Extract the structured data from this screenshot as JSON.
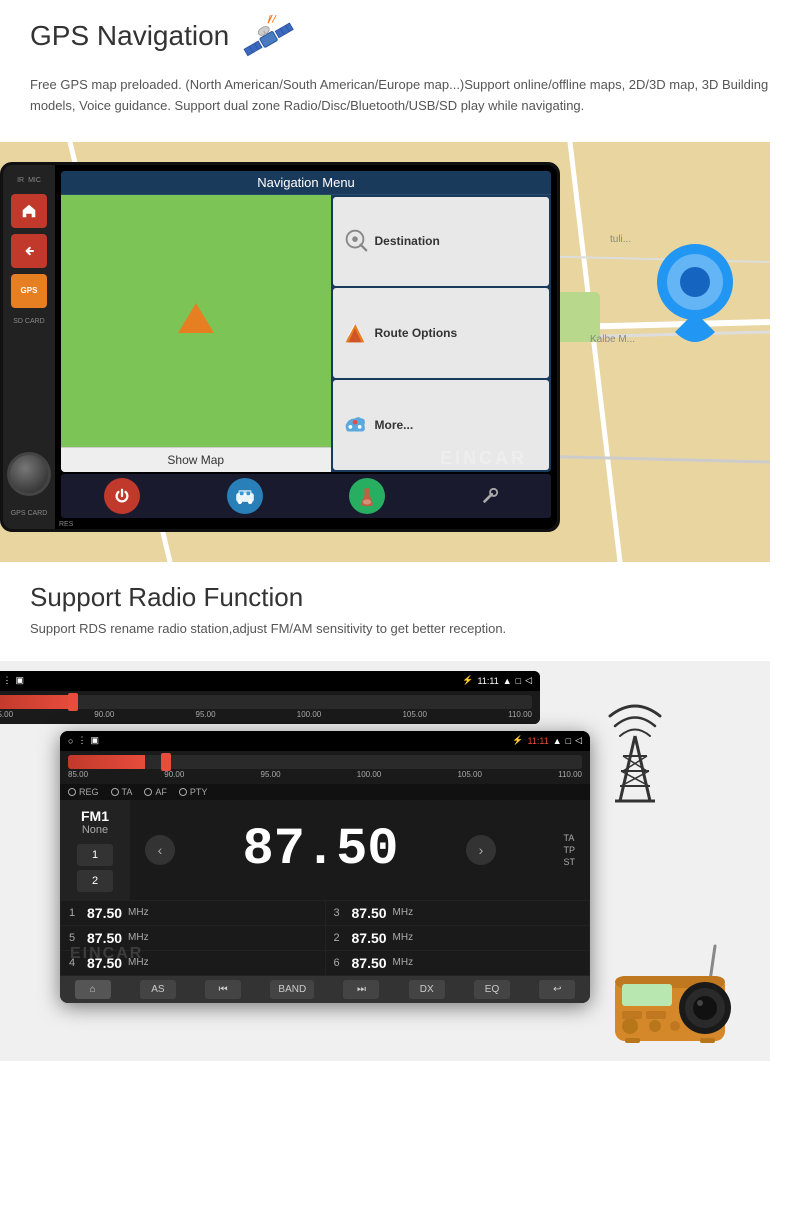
{
  "gps": {
    "title": "GPS Navigation",
    "description": "Free GPS map preloaded. (North American/South American/Europe map...)Support online/offline maps, 2D/3D map, 3D Building models, Voice guidance.\nSupport dual zone Radio/Disc/Bluetooth/USB/SD play while navigating.",
    "nav_menu_title": "Navigation Menu",
    "destination_label": "Destination",
    "route_options_label": "Route Options",
    "more_label": "More...",
    "show_map_label": "Show Map",
    "gps_side_label": "GPS",
    "ir_label": "IR",
    "mic_label": "MIC",
    "res_label": "RES",
    "sd_label": "SD CARD",
    "gps_slot_label": "GPS CARD",
    "eincar_label": "EINCAR"
  },
  "radio": {
    "title": "Support Radio Function",
    "description": "Support RDS rename radio station,adjust FM/AM sensitivity to get better reception.",
    "fm_label": "FM1",
    "fm_sub": "None",
    "frequency": "87.50",
    "freq_min": "85.00",
    "freq_marks": [
      "85.00",
      "90.00",
      "95.00",
      "100.00",
      "105.00",
      "110.00"
    ],
    "time": "11:11",
    "ta_label": "TA",
    "tp_label": "TP",
    "st_label": "ST",
    "reg_options": [
      "REG",
      "TA",
      "AF",
      "PTY"
    ],
    "presets": [
      {
        "num": "1",
        "freq": "87.50",
        "mhz": "MHz"
      },
      {
        "num": "3",
        "freq": "87.50",
        "mhz": "MHz"
      },
      {
        "num": "5",
        "freq": "87.50",
        "mhz": "MHz"
      },
      {
        "num": "2",
        "freq": "87.50",
        "mhz": "MHz"
      },
      {
        "num": "4",
        "freq": "87.50",
        "mhz": "MHz"
      },
      {
        "num": "6",
        "freq": "87.50",
        "mhz": "MHz"
      }
    ],
    "bottom_btns": [
      "🏠",
      "AS",
      "⏮",
      "BAND",
      "⏭",
      "DX",
      "EQ",
      "↩"
    ],
    "eincar_label": "EINCAR"
  },
  "icons": {
    "satellite": "🛰️",
    "home": "⌂",
    "back": "↩",
    "power": "⏻",
    "tools": "🔧",
    "bluetooth": "⚡",
    "signal_tower": "📡"
  }
}
